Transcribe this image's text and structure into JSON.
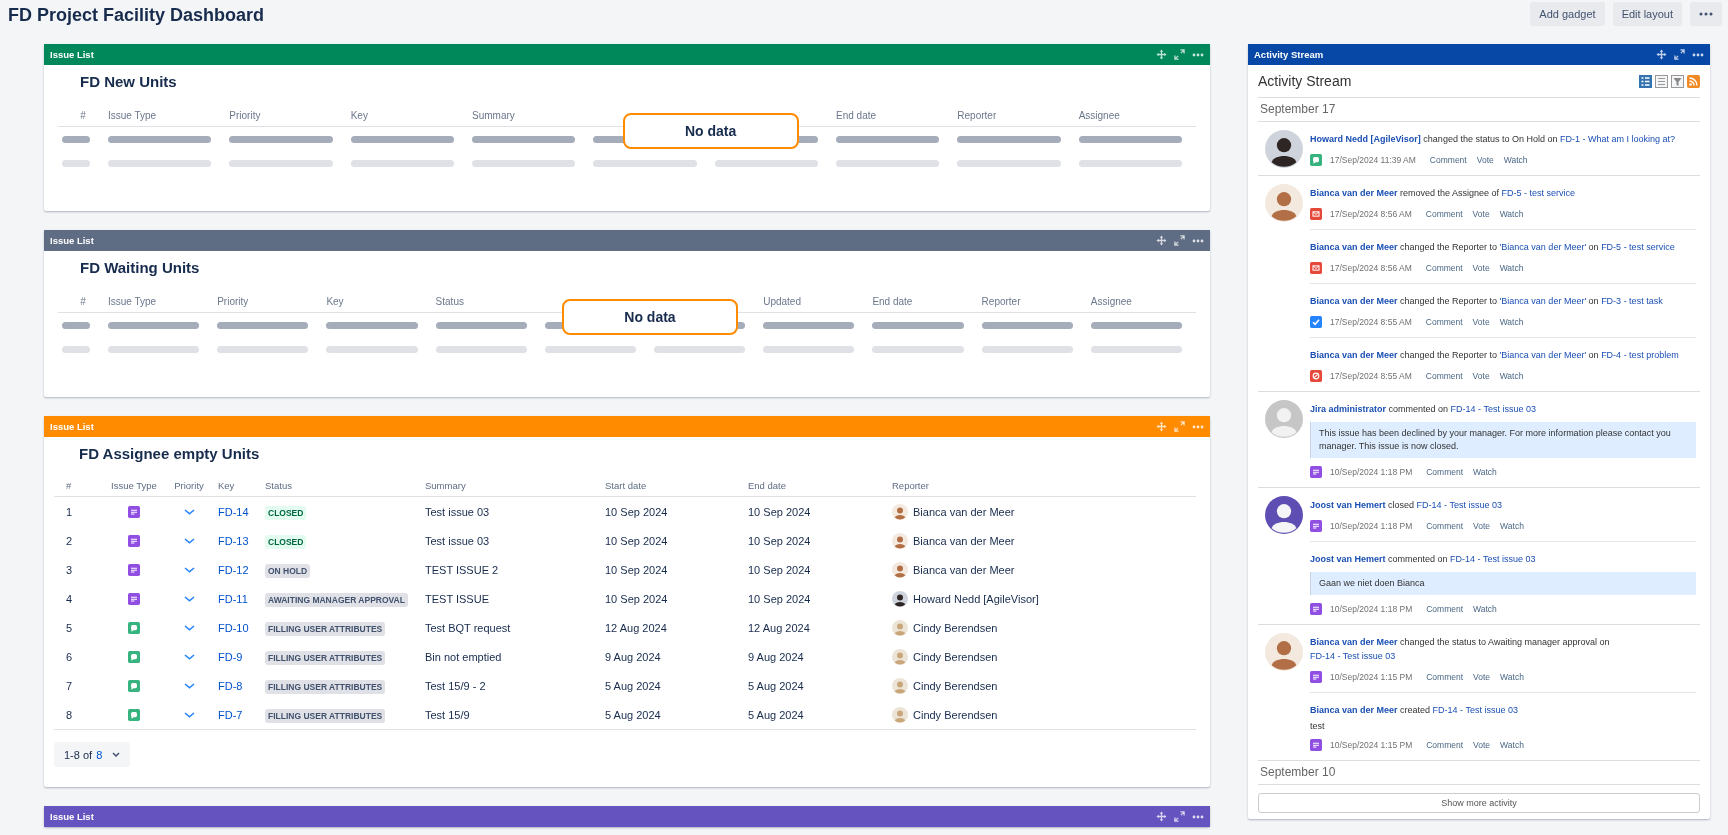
{
  "page": {
    "title": "FD Project Facility Dashboard",
    "buttons": [
      "Add gadget",
      "Edit layout"
    ]
  },
  "gadgets": [
    {
      "header": "Issue List",
      "color": "#00875a",
      "kind": "skeleton",
      "title": "FD New Units",
      "message": "No data",
      "columns": [
        {
          "label": "#"
        },
        {
          "label": "Issue Type"
        },
        {
          "label": "Priority"
        },
        {
          "label": "Key"
        },
        {
          "label": "Summary"
        },
        {
          "covered": true
        },
        {
          "covered": true
        },
        {
          "label": "End date"
        },
        {
          "label": "Reporter"
        },
        {
          "label": "Assignee"
        }
      ]
    },
    {
      "header": "Issue List",
      "color": "#5e6c84",
      "kind": "skeleton",
      "title": "FD Waiting Units",
      "message": "No data",
      "columns": [
        {
          "label": "#"
        },
        {
          "label": "Issue Type"
        },
        {
          "label": "Priority"
        },
        {
          "label": "Key"
        },
        {
          "label": "Status"
        },
        {
          "covered": true
        },
        {
          "covered": true
        },
        {
          "label": "Updated"
        },
        {
          "label": "End date"
        },
        {
          "label": "Reporter"
        },
        {
          "label": "Assignee"
        }
      ]
    },
    {
      "header": "Issue List",
      "color": "#ff8b00",
      "kind": "table",
      "title": "FD Assignee empty Units",
      "columns": [
        "#",
        "Issue Type",
        "Priority",
        "Key",
        "Status",
        "Summary",
        "Start date",
        "End date",
        "Reporter"
      ],
      "rows": [
        {
          "num": "1",
          "kind": "note",
          "key": "FD-14",
          "status": {
            "text": "CLOSED",
            "kind": "success"
          },
          "summary": "Test issue 03",
          "start": "10 Sep 2024",
          "end": "10 Sep 2024",
          "reporter": {
            "name": "Bianca van der Meer",
            "kind": "light"
          }
        },
        {
          "num": "2",
          "kind": "note",
          "key": "FD-13",
          "status": {
            "text": "CLOSED",
            "kind": "success"
          },
          "summary": "Test issue 03",
          "start": "10 Sep 2024",
          "end": "10 Sep 2024",
          "reporter": {
            "name": "Bianca van der Meer",
            "kind": "light"
          }
        },
        {
          "num": "3",
          "kind": "note",
          "key": "FD-12",
          "status": {
            "text": "ON HOLD",
            "kind": "default"
          },
          "summary": "TEST ISSUE 2",
          "start": "10 Sep 2024",
          "end": "10 Sep 2024",
          "reporter": {
            "name": "Bianca van der Meer",
            "kind": "light"
          }
        },
        {
          "num": "4",
          "kind": "note",
          "key": "FD-11",
          "status": {
            "text": "AWAITING MANAGER APPROVAL",
            "kind": "default"
          },
          "summary": "TEST ISSUE",
          "start": "10 Sep 2024",
          "end": "10 Sep 2024",
          "reporter": {
            "name": "Howard Nedd [AgileVisor]",
            "kind": "dark"
          }
        },
        {
          "num": "5",
          "kind": "chat",
          "key": "FD-10",
          "status": {
            "text": "FILLING USER ATTRIBUTES",
            "kind": "default"
          },
          "summary": "Test BQT request",
          "start": "12 Aug 2024",
          "end": "12 Aug 2024",
          "reporter": {
            "name": "Cindy Berendsen",
            "kind": "blond"
          }
        },
        {
          "num": "6",
          "kind": "chat",
          "key": "FD-9",
          "status": {
            "text": "FILLING USER ATTRIBUTES",
            "kind": "default"
          },
          "summary": "Bin not emptied",
          "start": "9 Aug 2024",
          "end": "9 Aug 2024",
          "reporter": {
            "name": "Cindy Berendsen",
            "kind": "blond"
          }
        },
        {
          "num": "7",
          "kind": "chat",
          "key": "FD-8",
          "status": {
            "text": "FILLING USER ATTRIBUTES",
            "kind": "default"
          },
          "summary": "Test 15/9 - 2",
          "start": "5 Aug 2024",
          "end": "5 Aug 2024",
          "reporter": {
            "name": "Cindy Berendsen",
            "kind": "blond"
          }
        },
        {
          "num": "8",
          "kind": "chat",
          "key": "FD-7",
          "status": {
            "text": "FILLING USER ATTRIBUTES",
            "kind": "default"
          },
          "summary": "Test 15/9",
          "start": "5 Aug 2024",
          "end": "5 Aug 2024",
          "reporter": {
            "name": "Cindy Berendsen",
            "kind": "blond"
          }
        }
      ],
      "pagination": {
        "range": "1-8 of",
        "total": "8"
      }
    },
    {
      "header": "Issue List",
      "color": "#6554c0",
      "kind": "header_only"
    }
  ],
  "activity": {
    "header": "Activity Stream",
    "title": "Activity Stream",
    "days": [
      {
        "date": "September 17",
        "groups": [
          {
            "kind": "dark",
            "entries": [
              {
                "parts": [
                  {
                    "kind": "user",
                    "text": "Howard Nedd [AgileVisor]"
                  },
                  {
                    "kind": "plain",
                    "text": " changed the status to On Hold on "
                  },
                  {
                    "kind": "link",
                    "text": "FD-1 - What am I looking at?"
                  }
                ],
                "kind": "chat",
                "time": "17/Sep/2024 11:39 AM",
                "actions": [
                  "Comment",
                  "Vote",
                  "Watch"
                ]
              }
            ]
          },
          {
            "kind": "light",
            "entries": [
              {
                "parts": [
                  {
                    "kind": "user",
                    "text": "Bianca van der Meer"
                  },
                  {
                    "kind": "plain",
                    "text": " removed the Assignee of "
                  },
                  {
                    "kind": "link",
                    "text": "FD-5 - test service"
                  }
                ],
                "kind": "mail",
                "time": "17/Sep/2024 8:56 AM",
                "actions": [
                  "Comment",
                  "Vote",
                  "Watch"
                ]
              },
              {
                "parts": [
                  {
                    "kind": "user",
                    "text": "Bianca van der Meer"
                  },
                  {
                    "kind": "plain",
                    "text": " changed the Reporter to "
                  },
                  {
                    "kind": "link",
                    "text": "'Bianca van der Meer'"
                  },
                  {
                    "kind": "plain",
                    "text": " on "
                  },
                  {
                    "kind": "link",
                    "text": "FD-5 - test service"
                  }
                ],
                "kind": "mail",
                "time": "17/Sep/2024 8:56 AM",
                "actions": [
                  "Comment",
                  "Vote",
                  "Watch"
                ]
              },
              {
                "parts": [
                  {
                    "kind": "user",
                    "text": "Bianca van der Meer"
                  },
                  {
                    "kind": "plain",
                    "text": " changed the Reporter to "
                  },
                  {
                    "kind": "link",
                    "text": "'Bianca van der Meer'"
                  },
                  {
                    "kind": "plain",
                    "text": " on "
                  },
                  {
                    "kind": "link",
                    "text": "FD-3 - test task"
                  }
                ],
                "kind": "check",
                "time": "17/Sep/2024 8:55 AM",
                "actions": [
                  "Comment",
                  "Vote",
                  "Watch"
                ]
              },
              {
                "parts": [
                  {
                    "kind": "user",
                    "text": "Bianca van der Meer"
                  },
                  {
                    "kind": "plain",
                    "text": " changed the Reporter to "
                  },
                  {
                    "kind": "link",
                    "text": "'Bianca van der Meer'"
                  },
                  {
                    "kind": "plain",
                    "text": " on "
                  },
                  {
                    "kind": "link",
                    "text": "FD-4 - test problem"
                  }
                ],
                "kind": "block",
                "time": "17/Sep/2024 8:55 AM",
                "actions": [
                  "Comment",
                  "Vote",
                  "Watch"
                ]
              }
            ]
          },
          {
            "kind": "default",
            "entries": [
              {
                "parts": [
                  {
                    "kind": "user",
                    "text": "Jira administrator"
                  },
                  {
                    "kind": "plain",
                    "text": " commented on "
                  },
                  {
                    "kind": "link",
                    "text": "FD-14 - Test issue 03"
                  }
                ],
                "comment": "This issue has been declined by your manager. For more information please contact you manager. This issue is now closed.",
                "kind": "note",
                "time": "10/Sep/2024 1:18 PM",
                "actions": [
                  "Comment",
                  "Watch"
                ]
              }
            ]
          },
          {
            "kind": "purple",
            "entries": [
              {
                "parts": [
                  {
                    "kind": "user",
                    "text": "Joost van Hemert"
                  },
                  {
                    "kind": "plain",
                    "text": " closed "
                  },
                  {
                    "kind": "link",
                    "text": "FD-14 - Test issue 03"
                  }
                ],
                "kind": "note",
                "time": "10/Sep/2024 1:18 PM",
                "actions": [
                  "Comment",
                  "Vote",
                  "Watch"
                ]
              },
              {
                "parts": [
                  {
                    "kind": "user",
                    "text": "Joost van Hemert"
                  },
                  {
                    "kind": "plain",
                    "text": " commented on "
                  },
                  {
                    "kind": "link",
                    "text": "FD-14 - Test issue 03"
                  }
                ],
                "comment": "Gaan we niet doen Bianca",
                "kind": "note",
                "time": "10/Sep/2024 1:18 PM",
                "actions": [
                  "Comment",
                  "Watch"
                ]
              }
            ]
          },
          {
            "kind": "light",
            "entries": [
              {
                "parts": [
                  {
                    "kind": "user",
                    "text": "Bianca van der Meer"
                  },
                  {
                    "kind": "plain",
                    "text": " changed the status to Awaiting manager approval on "
                  },
                  {
                    "kind": "link",
                    "text": "FD-14 - Test issue 03"
                  }
                ],
                "kind": "note",
                "time": "10/Sep/2024 1:15 PM",
                "actions": [
                  "Comment",
                  "Vote",
                  "Watch"
                ]
              },
              {
                "parts": [
                  {
                    "kind": "user",
                    "text": "Bianca van der Meer"
                  },
                  {
                    "kind": "plain",
                    "text": " created "
                  },
                  {
                    "kind": "link",
                    "text": "FD-14 - Test issue 03"
                  }
                ],
                "body": "test",
                "kind": "note",
                "time": "10/Sep/2024 1:15 PM",
                "actions": [
                  "Comment",
                  "Vote",
                  "Watch"
                ]
              }
            ]
          }
        ]
      },
      {
        "date": "September 10"
      }
    ],
    "more_button": "Show more activity"
  }
}
